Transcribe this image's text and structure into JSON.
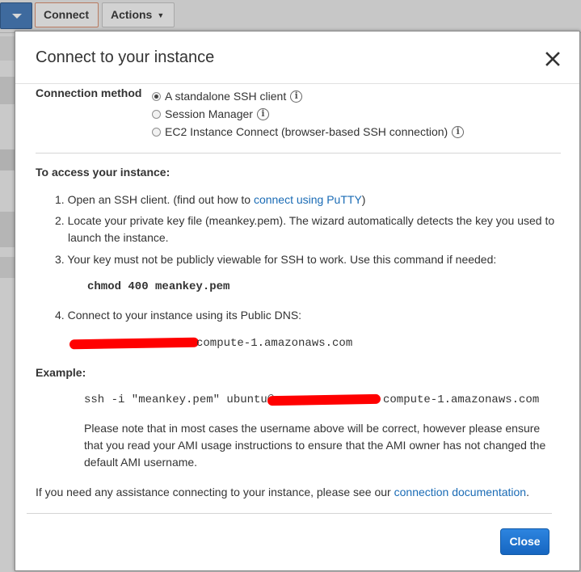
{
  "background": {
    "connect_label": "Connect",
    "actions_label": "Actions"
  },
  "modal": {
    "title": "Connect to your instance",
    "connection_method_label": "Connection method",
    "methods": [
      {
        "label": "A standalone SSH client",
        "checked": true
      },
      {
        "label": "Session Manager",
        "checked": false
      },
      {
        "label": "EC2 Instance Connect (browser-based SSH connection)",
        "checked": false
      }
    ],
    "access_heading": "To access your instance:",
    "steps": {
      "s1_text": "Open an SSH client. (find out how to ",
      "s1_link": "connect using PuTTY",
      "s1_end": ")",
      "s2_line1": "Locate your private key file (meankey.pem). The wizard automatically detects the key you used to",
      "s2_line2": "launch the instance.",
      "s3_text": "Your key must not be publicly viewable for SSH to work. Use this command if needed:",
      "s3_command": "chmod 400 meankey.pem",
      "s4_text": "Connect to your instance using its Public DNS:",
      "s4_dns_suffix": "compute-1.amazonaws.com"
    },
    "example_heading": "Example:",
    "example_command_prefix": "ssh -i \"meankey.pem\" ubuntu@",
    "example_command_suffix": "compute-1.amazonaws.com",
    "note_line1": "Please note that in most cases the username above will be correct, however please ensure",
    "note_line2": "that you read your AMI usage instructions to ensure that the AMI owner has not changed the",
    "note_line3": "default AMI username.",
    "assist_text": "If you need any assistance connecting to your instance, please see our ",
    "assist_link": "connection documentation",
    "assist_end": ".",
    "close_button": "Close"
  },
  "colors": {
    "link": "#1a6bb5",
    "primary_button": "#1d73d0",
    "redaction": "#ff0000"
  }
}
